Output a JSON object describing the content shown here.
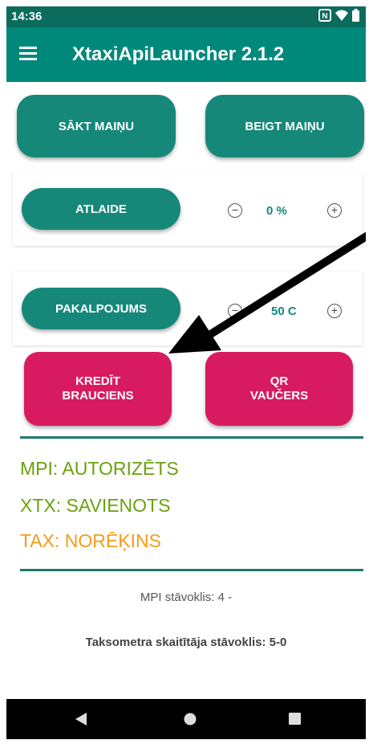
{
  "status_bar": {
    "time": "14:36",
    "icons": [
      "nfc-icon",
      "wifi-icon",
      "battery-icon"
    ]
  },
  "app_bar": {
    "title": "XtaxiApiLauncher 2.1.2"
  },
  "shift": {
    "start_label": "SĀKT MAIŅU",
    "end_label": "BEIGT MAIŅU"
  },
  "discount": {
    "label": "ATLAIDE",
    "value": "0 %",
    "minus": "−",
    "plus": "+"
  },
  "service": {
    "label": "PAKALPOJUMS",
    "value": "50 C",
    "minus": "−",
    "plus": "+"
  },
  "actions": {
    "credit_ride": "KREDĪT\nBRAUCIENS",
    "qr_voucher": "QR\nVAUČERS"
  },
  "statuses": {
    "mpi": {
      "text": "MPI: AUTORIZĒTS",
      "color": "#6aa10f"
    },
    "xtx": {
      "text": "XTX: SAVIENOTS",
      "color": "#6aa10f"
    },
    "tax": {
      "text": "TAX: NORĒĶINS",
      "color": "#f59c1a"
    }
  },
  "info": {
    "mpi_state": "MPI stāvoklis: 4 -",
    "taximeter_state": "Taksometra skaitītāja stāvoklis: 5-0"
  },
  "colors": {
    "primary": "#00897b",
    "primary_dark": "#0b6b5c",
    "accent": "#d81b60"
  }
}
